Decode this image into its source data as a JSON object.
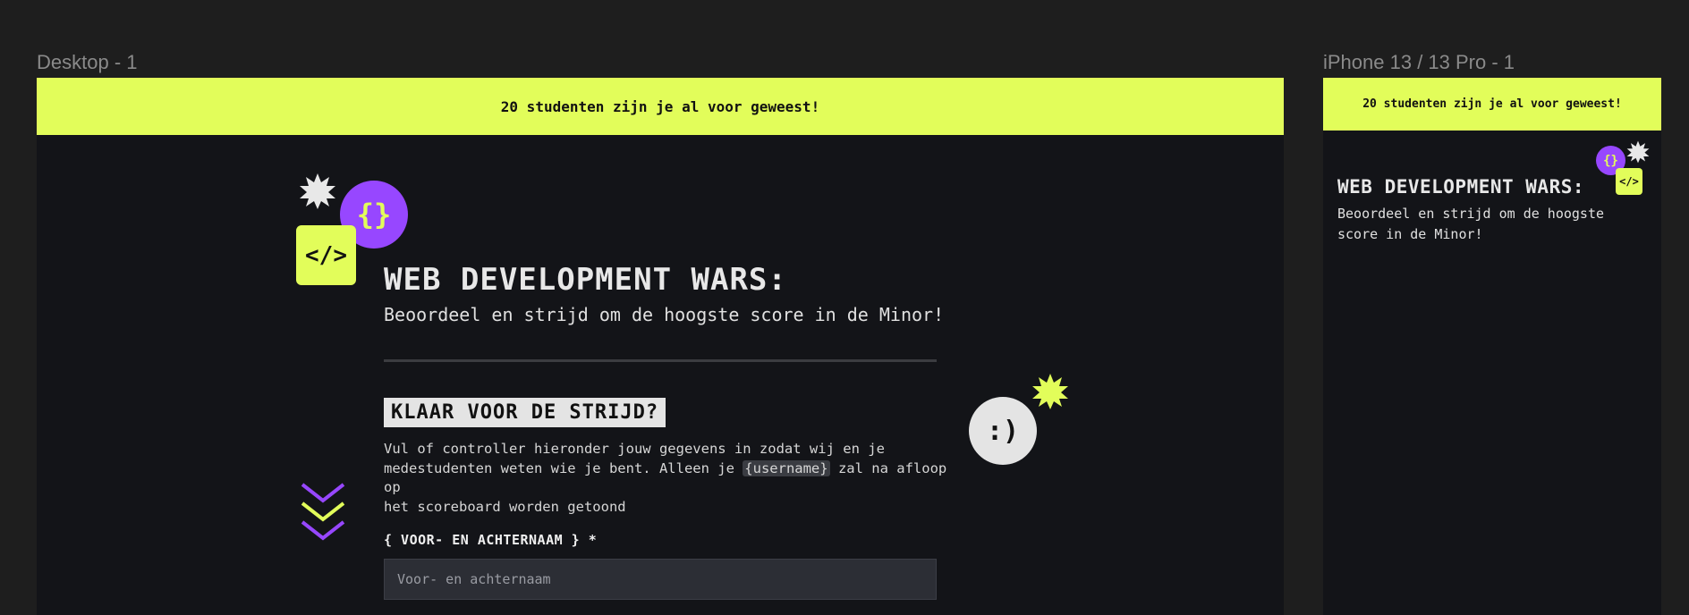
{
  "canvas": {
    "desktop_frame_label": "Desktop - 1",
    "mobile_frame_label": "iPhone 13 / 13 Pro - 1"
  },
  "banner": {
    "text": "20 studenten zijn je al voor geweest!"
  },
  "hero": {
    "title": "WEB DEVELOPMENT WARS:",
    "subtitle": "Beoordeel en strijd om de hoogste score in de Minor!",
    "mobile_subtitle_line1": "Beoordeel en strijd om de hoogste",
    "mobile_subtitle_line2": "score in de Minor!"
  },
  "stickers": {
    "braces": "{}",
    "code": "</>",
    "smiley": ":)"
  },
  "section": {
    "heading": "KLAAR VOOR DE STRIJD?",
    "para_line1": "Vul of controller hieronder jouw gegevens in zodat wij en je",
    "para_line2_a": "medestudenten weten wie je bent. Alleen je ",
    "para_line2_code": "{username}",
    "para_line2_b": " zal na afloop op",
    "para_line3": "het scoreboard worden getoond"
  },
  "form": {
    "name_label": "{ VOOR- EN ACHTERNAAM } *",
    "name_placeholder": "Voor- en achternaam"
  },
  "colors": {
    "accent_lime": "#e2fd5a",
    "accent_purple": "#9747ff",
    "frame_bg": "#131418",
    "canvas_bg": "#1e1e1e"
  }
}
